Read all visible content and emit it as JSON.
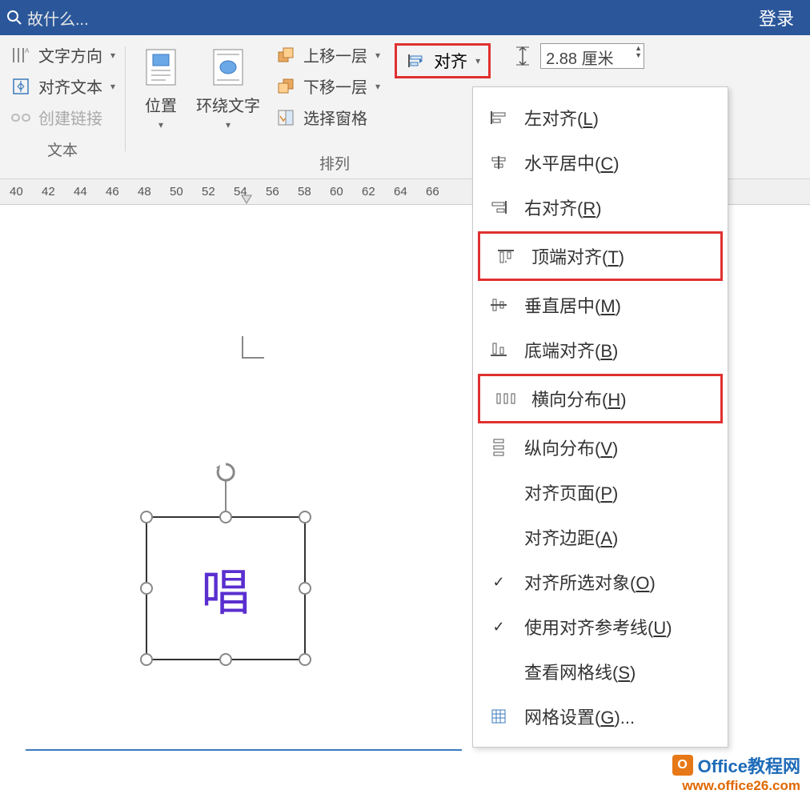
{
  "titlebar": {
    "search_placeholder": "故什么...",
    "login": "登录"
  },
  "ribbon": {
    "text_group": {
      "direction": "文字方向",
      "align_text": "对齐文本",
      "create_link": "创建链接",
      "label": "文本"
    },
    "arrange_group": {
      "position": "位置",
      "wrap": "环绕文字",
      "bring_forward": "上移一层",
      "send_backward": "下移一层",
      "selection_pane": "选择窗格",
      "align": "对齐",
      "label": "排列"
    },
    "size_group": {
      "value": "2.88 厘米"
    }
  },
  "dropdown": {
    "items": [
      {
        "label": "左对齐",
        "key": "L",
        "icon": "align-left"
      },
      {
        "label": "水平居中",
        "key": "C",
        "icon": "align-center-h"
      },
      {
        "label": "右对齐",
        "key": "R",
        "icon": "align-right"
      },
      {
        "label": "顶端对齐",
        "key": "T",
        "icon": "align-top",
        "highlight": true
      },
      {
        "label": "垂直居中",
        "key": "M",
        "icon": "align-middle-v"
      },
      {
        "label": "底端对齐",
        "key": "B",
        "icon": "align-bottom"
      },
      {
        "label": "横向分布",
        "key": "H",
        "icon": "dist-h",
        "highlight": true
      },
      {
        "label": "纵向分布",
        "key": "V",
        "icon": "dist-v"
      },
      {
        "label": "对齐页面",
        "key": "P",
        "icon": ""
      },
      {
        "label": "对齐边距",
        "key": "A",
        "icon": ""
      },
      {
        "label": "对齐所选对象",
        "key": "O",
        "icon": "",
        "checked": true
      },
      {
        "label": "使用对齐参考线",
        "key": "U",
        "icon": "",
        "checked": true
      },
      {
        "label": "查看网格线",
        "key": "S",
        "icon": ""
      },
      {
        "label": "网格设置",
        "key": "G",
        "icon": "grid",
        "suffix": "..."
      }
    ]
  },
  "ruler": {
    "ticks": [
      "40",
      "42",
      "44",
      "46",
      "48",
      "50",
      "52",
      "54",
      "56",
      "58",
      "60",
      "62",
      "64",
      "66"
    ]
  },
  "canvas": {
    "textbox_char": "唱"
  },
  "watermark": {
    "title": "Office教程网",
    "url": "www.office26.com"
  }
}
